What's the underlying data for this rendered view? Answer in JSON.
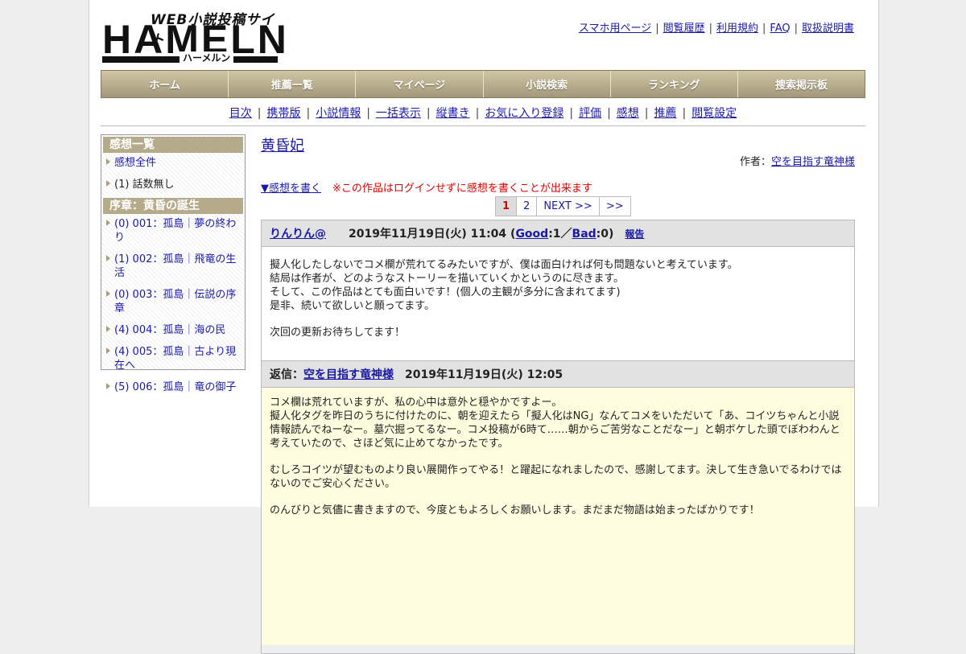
{
  "logo": {
    "tagline": "WEB小説投稿サイト",
    "name": "HAMELN",
    "kana": "ハーメルン"
  },
  "toplinks": [
    "スマホ用ページ",
    "閲覧履歴",
    "利用規約",
    "FAQ",
    "取扱説明書"
  ],
  "nav": [
    "ホーム",
    "推薦一覧",
    "マイページ",
    "小説検索",
    "ランキング",
    "捜索掲示板"
  ],
  "subnav": [
    "目次",
    "携帯版",
    "小説情報",
    "一括表示",
    "縦書き",
    "お気に入り登録",
    "評価",
    "感想",
    "推薦",
    "閲覧設定"
  ],
  "sidebar": {
    "head1": "感想一覧",
    "all_label": "感想全件",
    "no_episode": "(1) 話数無し",
    "head2": "序章：黄昏の誕生",
    "chapters": [
      "(0) 001：孤島｜夢の終わり",
      "(1) 002：孤島｜飛竜の生活",
      "(0) 003：孤島｜伝説の序章",
      "(4) 004：孤島｜海の民",
      "(4) 005：孤島｜古より現在へ",
      "(5) 006：孤島｜竜の御子"
    ]
  },
  "main": {
    "title": "黄昏妃",
    "author_prefix": "作者：",
    "author": "空を目指す竜神様",
    "write_link": "▼感想を書く",
    "warning": "※この作品はログインせずに感想を書くことが出来ます",
    "pager": [
      "1",
      "2",
      "NEXT >>",
      ">>"
    ]
  },
  "post": {
    "name": "りんりん@",
    "date": "2019年11月19日(火) 11:04 (",
    "good_label": "Good",
    "good_count": ":1／",
    "bad_label": "Bad",
    "bad_count": ":0)",
    "report": "報告",
    "body": [
      "擬人化したしないでコメ欄が荒れてるみたいですが、僕は面白ければ何も問題ないと考えています。",
      "結局は作者が、どのようなストーリーを描いていくかというのに尽きます。",
      "そして、この作品はとても面白いです！(個人の主観が多分に含まれてます)",
      "是非、続いて欲しいと願ってます。",
      "次回の更新お待ちしてます！"
    ]
  },
  "reply": {
    "label": "返信：",
    "name": "空を目指す竜神様",
    "date": "2019年11月19日(火) 12:05",
    "body": [
      "コメ欄は荒れていますが、私の心中は意外と穏やかですよー。",
      "擬人化タグを昨日のうちに付けたのに、朝を迎えたら「擬人化はNG」なんてコメをいただいて「あ、コイツちゃんと小説情報読んでねーなー。墓穴掘ってるなー。コメ投稿が6時て……朝からご苦労なことだなー」と朝ボケした頭でぼわわんと考えていたので、さほど気に止めてなかったです。",
      "むしろコイツが望むものより良い展開作ってやる！と躍起になれましたので、感謝してます。決して生き急いでるわけではないのでご安心ください。",
      "のんびりと気儘に書きますので、今度ともよろしくお願いします。まだまだ物語は始まったばかりです！"
    ]
  }
}
